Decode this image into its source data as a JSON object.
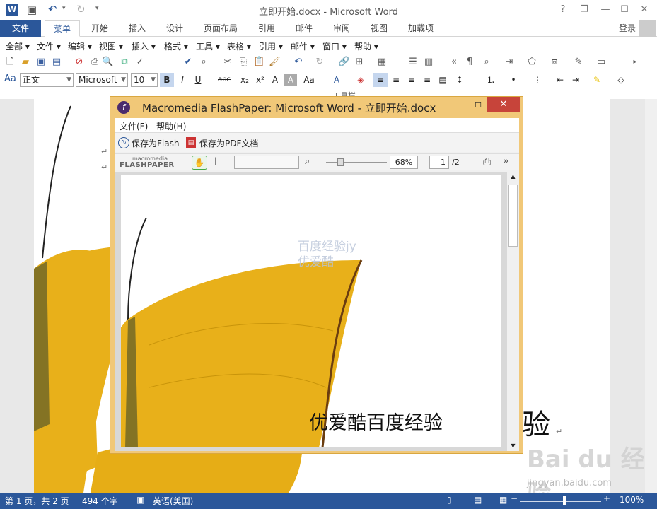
{
  "window": {
    "title": "立即开始.docx - Microsoft Word"
  },
  "title_controls": {
    "help": "?",
    "restore": "❐",
    "minimize": "—",
    "maximize": "☐",
    "close": "✕"
  },
  "ribbon_tabs": [
    {
      "label": "文件"
    },
    {
      "label": "菜单"
    },
    {
      "label": "开始"
    },
    {
      "label": "插入"
    },
    {
      "label": "设计"
    },
    {
      "label": "页面布局"
    },
    {
      "label": "引用"
    },
    {
      "label": "邮件"
    },
    {
      "label": "审阅"
    },
    {
      "label": "视图"
    },
    {
      "label": "加载项"
    }
  ],
  "account": {
    "login": "登录"
  },
  "classic_menu": [
    "全部",
    "文件",
    "编辑",
    "视图",
    "插入",
    "格式",
    "工具",
    "表格",
    "引用",
    "邮件",
    "窗口",
    "帮助"
  ],
  "format": {
    "style": "正文",
    "font": "Microsoft",
    "size": "10"
  },
  "toolbar_group_label": "工具栏",
  "flashpaper": {
    "title": "Macromedia FlashPaper: Microsoft Word - 立即开始.docx",
    "menu": [
      "文件(F)",
      "帮助(H)"
    ],
    "save_flash": "保存为Flash",
    "save_pdf": "保存为PDF文档",
    "brand_top": "macromedia",
    "brand_bottom": "FLASHPAPER",
    "zoom": "68%",
    "page_current": "1",
    "page_total": "/2",
    "page_text": "优爱酷百度经验",
    "watermark_line1": "百度经验jy",
    "watermark_line2": "优爱酷"
  },
  "document": {
    "visible_text": "验",
    "para_mark": "↵"
  },
  "status": {
    "page": "第 1 页，共 2 页",
    "words": "494 个字",
    "language": "英语(美国)",
    "zoom": "100%"
  },
  "colors": {
    "word_blue": "#2b579a",
    "wing_yellow": "#e8b01a",
    "fp_frame": "#f1c878",
    "close_red": "#c7443a"
  }
}
